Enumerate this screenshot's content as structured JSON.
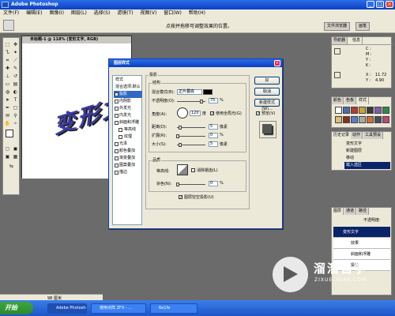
{
  "app": {
    "title": "Adobe Photoshop",
    "min": "_",
    "max": "□",
    "close": "×"
  },
  "menu": [
    "文件(F)",
    "编辑(E)",
    "图像(I)",
    "图层(L)",
    "选择(S)",
    "滤镜(T)",
    "视图(V)",
    "窗口(W)",
    "帮助(H)"
  ],
  "options": {
    "hint": "点按并拖移可调整效果的位置。",
    "tab1": "文件浏览器",
    "tab2": "画笔"
  },
  "document": {
    "title": "未标题-1 @ 118% (变形文字, RGB)",
    "canvas_text": "变形文"
  },
  "dialog": {
    "title": "图层样式",
    "close": "×",
    "styles": [
      "样式",
      "混合选项:默认",
      "投影",
      "内阴影",
      "外发光",
      "内发光",
      "斜面和浮雕",
      "等高线",
      "纹理",
      "光泽",
      "颜色叠加",
      "渐变叠加",
      "图案叠加",
      "描边"
    ],
    "section_title": "投影",
    "structure_title": "结构",
    "blend_mode_label": "混合模式(B):",
    "blend_mode_value": "正片叠底",
    "opacity_label": "不透明度(O):",
    "opacity_value": "75",
    "angle_label": "角度(A):",
    "angle_value": "120",
    "degree": "度",
    "global_light_label": "使用全局光(G)",
    "distance_label": "距离(D):",
    "distance_value": "5",
    "spread_label": "扩展(R):",
    "spread_value": "0",
    "size_label": "大小(S):",
    "size_value": "5",
    "px": "像素",
    "pct": "%",
    "quality_title": "品质",
    "contour_label": "等高线:",
    "antialias_label": "消除锯齿(L)",
    "noise_label": "杂色(N):",
    "noise_value": "0",
    "knockout_label": "图层挖空投影(U)",
    "ok": "好",
    "cancel": "取消",
    "new_style": "新建样式(W)...",
    "preview": "预览(V)"
  },
  "navigator": {
    "tabs": [
      "导航器",
      "信息"
    ],
    "c": "C :",
    "m": "M :",
    "y": "Y :",
    "k": "K :",
    "x": "X :",
    "yy": "Y :",
    "x_val": "11.72",
    "y_val": "4.90"
  },
  "swatches": {
    "tabs": [
      "颜色",
      "色板",
      "样式"
    ]
  },
  "history": {
    "tabs": [
      "历史记录",
      "动作",
      "工具预设"
    ],
    "items": [
      "变形文字",
      "新建图层",
      "移动",
      "载入选区"
    ]
  },
  "layers": {
    "tabs": [
      "图层",
      "通道",
      "路径"
    ],
    "opacity_label": "不透明度:",
    "items": [
      "变形文字",
      "效果",
      "斜面和浮雕",
      "投影"
    ]
  },
  "taskbar": {
    "start": "开始",
    "zoom": "98 厘米",
    "tasks": [
      "Adobe Photoshop",
      "使用点阵 ZFX - ...",
      "6e1fe"
    ]
  },
  "watermark": {
    "title": "溜溜自学",
    "url": "ZIXUE.3D66.COM"
  }
}
